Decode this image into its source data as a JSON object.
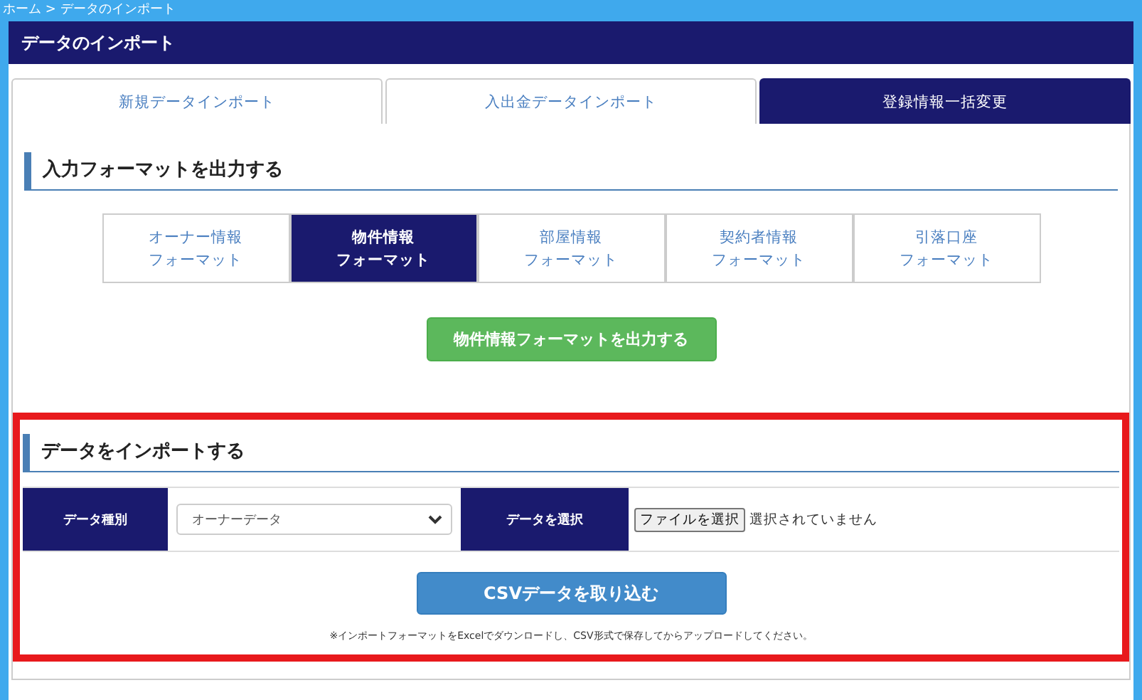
{
  "breadcrumb": "ホーム > データのインポート",
  "page_title": "データのインポート",
  "tabs": [
    {
      "label": "新規データインポート",
      "selected": false
    },
    {
      "label": "入出金データインポート",
      "selected": false
    },
    {
      "label": "登録情報一括変更",
      "selected": true
    }
  ],
  "export_section": {
    "heading": "入力フォーマットを出力する",
    "formats": [
      {
        "line1": "オーナー情報",
        "line2": "フォーマット",
        "selected": false
      },
      {
        "line1": "物件情報",
        "line2": "フォーマット",
        "selected": true
      },
      {
        "line1": "部屋情報",
        "line2": "フォーマット",
        "selected": false
      },
      {
        "line1": "契約者情報",
        "line2": "フォーマット",
        "selected": false
      },
      {
        "line1": "引落口座",
        "line2": "フォーマット",
        "selected": false
      }
    ],
    "button": "物件情報フォーマットを出力する"
  },
  "import_section": {
    "heading": "データをインポートする",
    "highlighted": true,
    "type_label": "データ種別",
    "type_value": "オーナーデータ",
    "file_label": "データを選択",
    "file_button": "ファイルを選択",
    "file_status": "選択されていません",
    "button": "CSVデータを取り込む",
    "note": "※インポートフォーマットをExcelでダウンロードし、CSV形式で保存してからアップロードしてください。"
  }
}
